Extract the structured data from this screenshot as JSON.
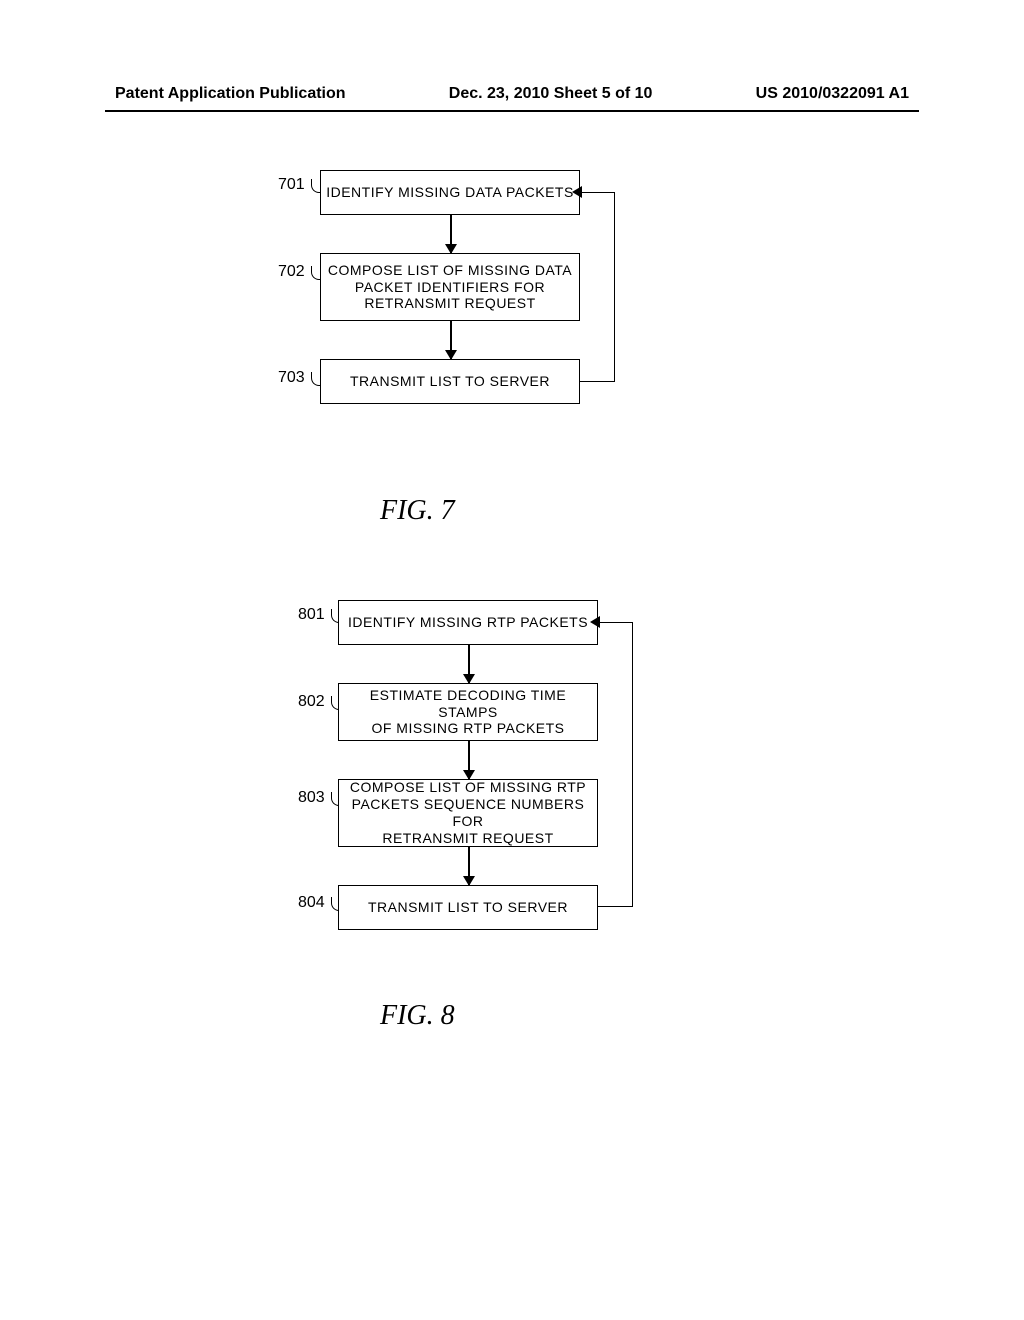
{
  "header": {
    "left": "Patent Application Publication",
    "center": "Dec. 23, 2010  Sheet 5 of 10",
    "right": "US 2010/0322091 A1"
  },
  "fig7": {
    "caption": "FIG. 7",
    "steps": [
      {
        "label": "701",
        "text": "IDENTIFY MISSING DATA PACKETS"
      },
      {
        "label": "702",
        "lines": [
          "COMPOSE LIST OF MISSING DATA",
          "PACKET IDENTIFIERS FOR",
          "RETRANSMIT REQUEST"
        ]
      },
      {
        "label": "703",
        "text": "TRANSMIT LIST TO SERVER"
      }
    ]
  },
  "fig8": {
    "caption": "FIG. 8",
    "steps": [
      {
        "label": "801",
        "text": "IDENTIFY MISSING RTP PACKETS"
      },
      {
        "label": "802",
        "lines": [
          "ESTIMATE DECODING TIME STAMPS",
          "OF MISSING RTP PACKETS"
        ]
      },
      {
        "label": "803",
        "lines": [
          "COMPOSE LIST OF MISSING RTP",
          "PACKETS SEQUENCE NUMBERS FOR",
          "RETRANSMIT REQUEST"
        ]
      },
      {
        "label": "804",
        "text": "TRANSMIT LIST TO SERVER"
      }
    ]
  },
  "chart_data": [
    {
      "type": "flowchart",
      "id": "FIG. 7",
      "nodes": [
        {
          "id": "701",
          "label": "IDENTIFY MISSING DATA PACKETS"
        },
        {
          "id": "702",
          "label": "COMPOSE LIST OF MISSING DATA PACKET IDENTIFIERS FOR RETRANSMIT REQUEST"
        },
        {
          "id": "703",
          "label": "TRANSMIT LIST TO SERVER"
        }
      ],
      "edges": [
        {
          "from": "701",
          "to": "702"
        },
        {
          "from": "702",
          "to": "703"
        },
        {
          "from": "703",
          "to": "701",
          "type": "feedback"
        }
      ]
    },
    {
      "type": "flowchart",
      "id": "FIG. 8",
      "nodes": [
        {
          "id": "801",
          "label": "IDENTIFY MISSING RTP PACKETS"
        },
        {
          "id": "802",
          "label": "ESTIMATE DECODING TIME STAMPS OF MISSING RTP PACKETS"
        },
        {
          "id": "803",
          "label": "COMPOSE LIST OF MISSING RTP PACKETS SEQUENCE NUMBERS FOR RETRANSMIT REQUEST"
        },
        {
          "id": "804",
          "label": "TRANSMIT LIST TO SERVER"
        }
      ],
      "edges": [
        {
          "from": "801",
          "to": "802"
        },
        {
          "from": "802",
          "to": "803"
        },
        {
          "from": "803",
          "to": "804"
        },
        {
          "from": "804",
          "to": "801",
          "type": "feedback"
        }
      ]
    }
  ]
}
